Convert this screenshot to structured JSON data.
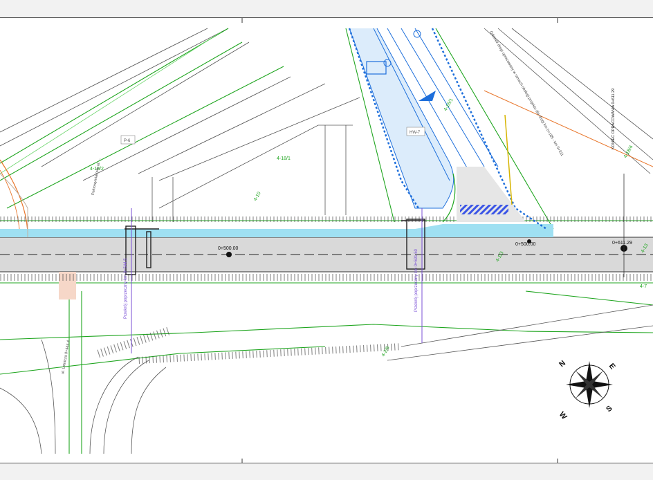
{
  "viewer": {
    "background": "#f2f2f2"
  },
  "drawing": {
    "colors": {
      "road": "#d9d9d9",
      "cycle_path": "#9fe0f2",
      "boundary": "#1fa51f",
      "design": "#1e6fdb",
      "annotation_purple": "#7a4fd6",
      "orange": "#e8762b",
      "yellow_note": "#d6b400",
      "hatch": "#3b55e6"
    },
    "chainage": {
      "start": "0+500.00",
      "end": "0+611.29",
      "mid": "0+500.00"
    },
    "end_note": "KONIEC OPRACOWANIA 0+611.29",
    "sections": {
      "left": "Przekrój poprzeczny km 0+544.5",
      "right": "Przekrój poprzeczny km 0+591.50"
    },
    "plot_labels": {
      "lot_a": "4-18/1",
      "lot_b": "4-18/2",
      "lot_c": "4-18/4",
      "lot_d": "4-16/1",
      "lot_e": "4-10",
      "lot_f": "4-2/6",
      "lot_g": "4-7",
      "lot_h": "4-13",
      "lot_i": "4-1/3"
    },
    "tags": {
      "hp7": "HW-7",
      "p6": "P-6"
    },
    "notes": {
      "road_note": "Odcinek drogi opracowany w ramach obsługi projektu dla drogi km 0+185 - km 0+311",
      "street_note": "Pełnowymiarowy ul. ...",
      "side_note": "ul. Lotnicza 0+444.4"
    },
    "compass": {
      "n": "N",
      "e": "E",
      "s": "S",
      "w": "W"
    }
  }
}
